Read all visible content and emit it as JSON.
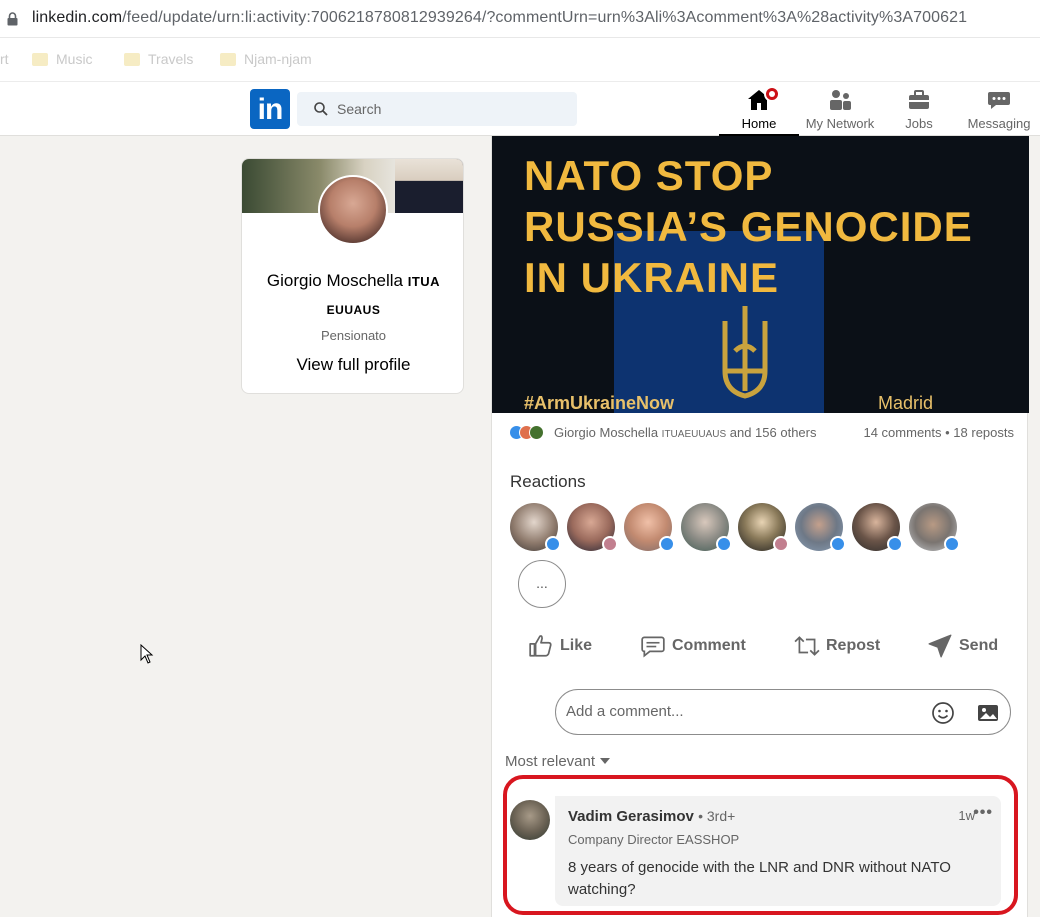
{
  "browser": {
    "url_host": "linkedin.com",
    "url_path": "/feed/update/urn:li:activity:7006218780812939264/?commentUrn=urn%3Ali%3Acomment%3A%28activity%3A700621",
    "bookmarks": [
      "rt",
      "Music",
      "Travels",
      "Njam-njam"
    ]
  },
  "nav": {
    "search_placeholder": "Search",
    "items": [
      {
        "label": "Home",
        "icon": "home-icon"
      },
      {
        "label": "My Network",
        "icon": "network-icon"
      },
      {
        "label": "Jobs",
        "icon": "briefcase-icon"
      },
      {
        "label": "Messaging",
        "icon": "messaging-icon"
      }
    ]
  },
  "profile": {
    "name": "Giorgio Moschella",
    "name_suffix_1": "ITUA",
    "name_suffix_2": "EUUAUS",
    "title": "Pensionato",
    "view_label": "View full profile"
  },
  "post": {
    "image_headline": [
      "NATO STOP",
      "RUSSIA’S GENOCIDE",
      "IN UKRAINE"
    ],
    "image_hashtag": "#ArmUkraineNow",
    "image_city": "Madrid",
    "reactors_name": "Giorgio Moschella",
    "reactors_suffix": "ITUAEUUAUS",
    "reactors_rest": "and 156 others",
    "counts": "14 comments • 18 reposts",
    "reactions_title": "Reactions",
    "more_label": "...",
    "actions": {
      "like": "Like",
      "comment": "Comment",
      "repost": "Repost",
      "send": "Send"
    },
    "comment_placeholder": "Add a comment...",
    "sort_label": "Most relevant"
  },
  "comment": {
    "author": "Vadim Gerasimov",
    "degree": "• 3rd+",
    "headline": "Company Director EASSHOP",
    "time": "1w",
    "more": "•••",
    "text": "8 years of genocide with the LNR and DNR without NATO watching?"
  },
  "colors": {
    "linkedin_blue": "#0a66c2",
    "highlight_red": "#d8161f",
    "notification_red": "#cc1016",
    "poster_text": "#f1b93f"
  }
}
